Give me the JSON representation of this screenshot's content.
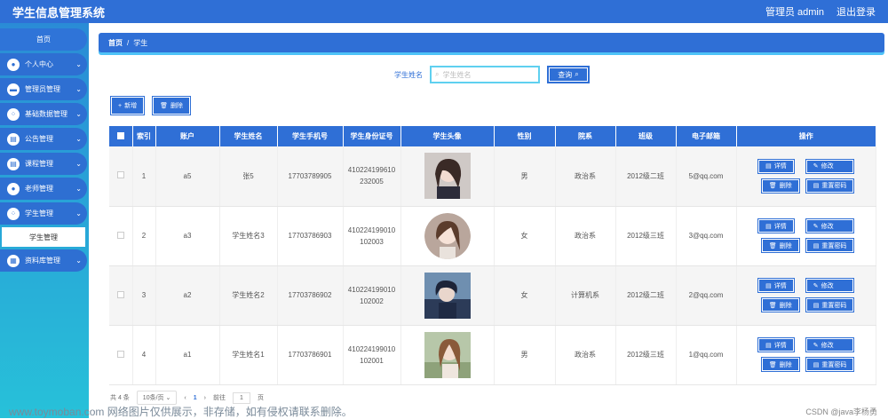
{
  "header": {
    "title": "学生信息管理系统",
    "user": "管理员 admin",
    "logout": "退出登录"
  },
  "sidebar": {
    "home": "首页",
    "items": [
      {
        "label": "个人中心",
        "icon": "user-icon",
        "glyph": "●"
      },
      {
        "label": "管理员管理",
        "icon": "monitor-icon",
        "glyph": "▬"
      },
      {
        "label": "基础数据管理",
        "icon": "grid-icon",
        "glyph": "⁘"
      },
      {
        "label": "公告管理",
        "icon": "notice-icon",
        "glyph": "▤"
      },
      {
        "label": "课程管理",
        "icon": "book-icon",
        "glyph": "▤"
      },
      {
        "label": "老师管理",
        "icon": "teacher-icon",
        "glyph": "●"
      },
      {
        "label": "学生管理",
        "icon": "student-icon",
        "glyph": "⁘"
      }
    ],
    "sub_item": "学生管理",
    "last_item": {
      "label": "资料库管理",
      "icon": "database-icon",
      "glyph": "▦"
    }
  },
  "breadcrumb": {
    "home": "首页",
    "sep": "/",
    "current": "学生"
  },
  "search": {
    "label": "学生姓名",
    "placeholder": "学生姓名",
    "button": "查询"
  },
  "actions": {
    "add": "新增",
    "delete": "删除"
  },
  "table": {
    "headers": [
      "索引",
      "账户",
      "学生姓名",
      "学生手机号",
      "学生身份证号",
      "学生头像",
      "性别",
      "院系",
      "班级",
      "电子邮箱",
      "操作"
    ],
    "rows": [
      {
        "index": "1",
        "account": "a5",
        "name": "张5",
        "phone": "17703789905",
        "id_card": "410224199610232005",
        "gender": "男",
        "dept": "政治系",
        "class": "2012级二班",
        "email": "5@qq.com"
      },
      {
        "index": "2",
        "account": "a3",
        "name": "学生姓名3",
        "phone": "17703786903",
        "id_card": "410224199010102003",
        "gender": "女",
        "dept": "政治系",
        "class": "2012级三班",
        "email": "3@qq.com"
      },
      {
        "index": "3",
        "account": "a2",
        "name": "学生姓名2",
        "phone": "17703786902",
        "id_card": "410224199010102002",
        "gender": "女",
        "dept": "计算机系",
        "class": "2012级二班",
        "email": "2@qq.com"
      },
      {
        "index": "4",
        "account": "a1",
        "name": "学生姓名1",
        "phone": "17703786901",
        "id_card": "410224199010102001",
        "gender": "男",
        "dept": "政治系",
        "class": "2012级三班",
        "email": "1@qq.com"
      }
    ],
    "ops": {
      "detail": "详情",
      "edit": "修改",
      "delete": "删除",
      "reset": "重置密码"
    }
  },
  "pager": {
    "total": "共 4 条",
    "size": "10条/页",
    "prev": "‹",
    "page": "1",
    "next": "›",
    "goto": "前往",
    "goto_page": "1",
    "page_unit": "页"
  },
  "watermark": "www.toymoban.com 网络图片仅供展示，非存储，如有侵权请联系删除。",
  "credit": "CSDN @java李杨勇",
  "colors": {
    "primary": "#2f6fd6",
    "sidebar_top": "#2a8bd6",
    "sidebar_bottom": "#27c1d9",
    "accent": "#5fd0f0"
  }
}
